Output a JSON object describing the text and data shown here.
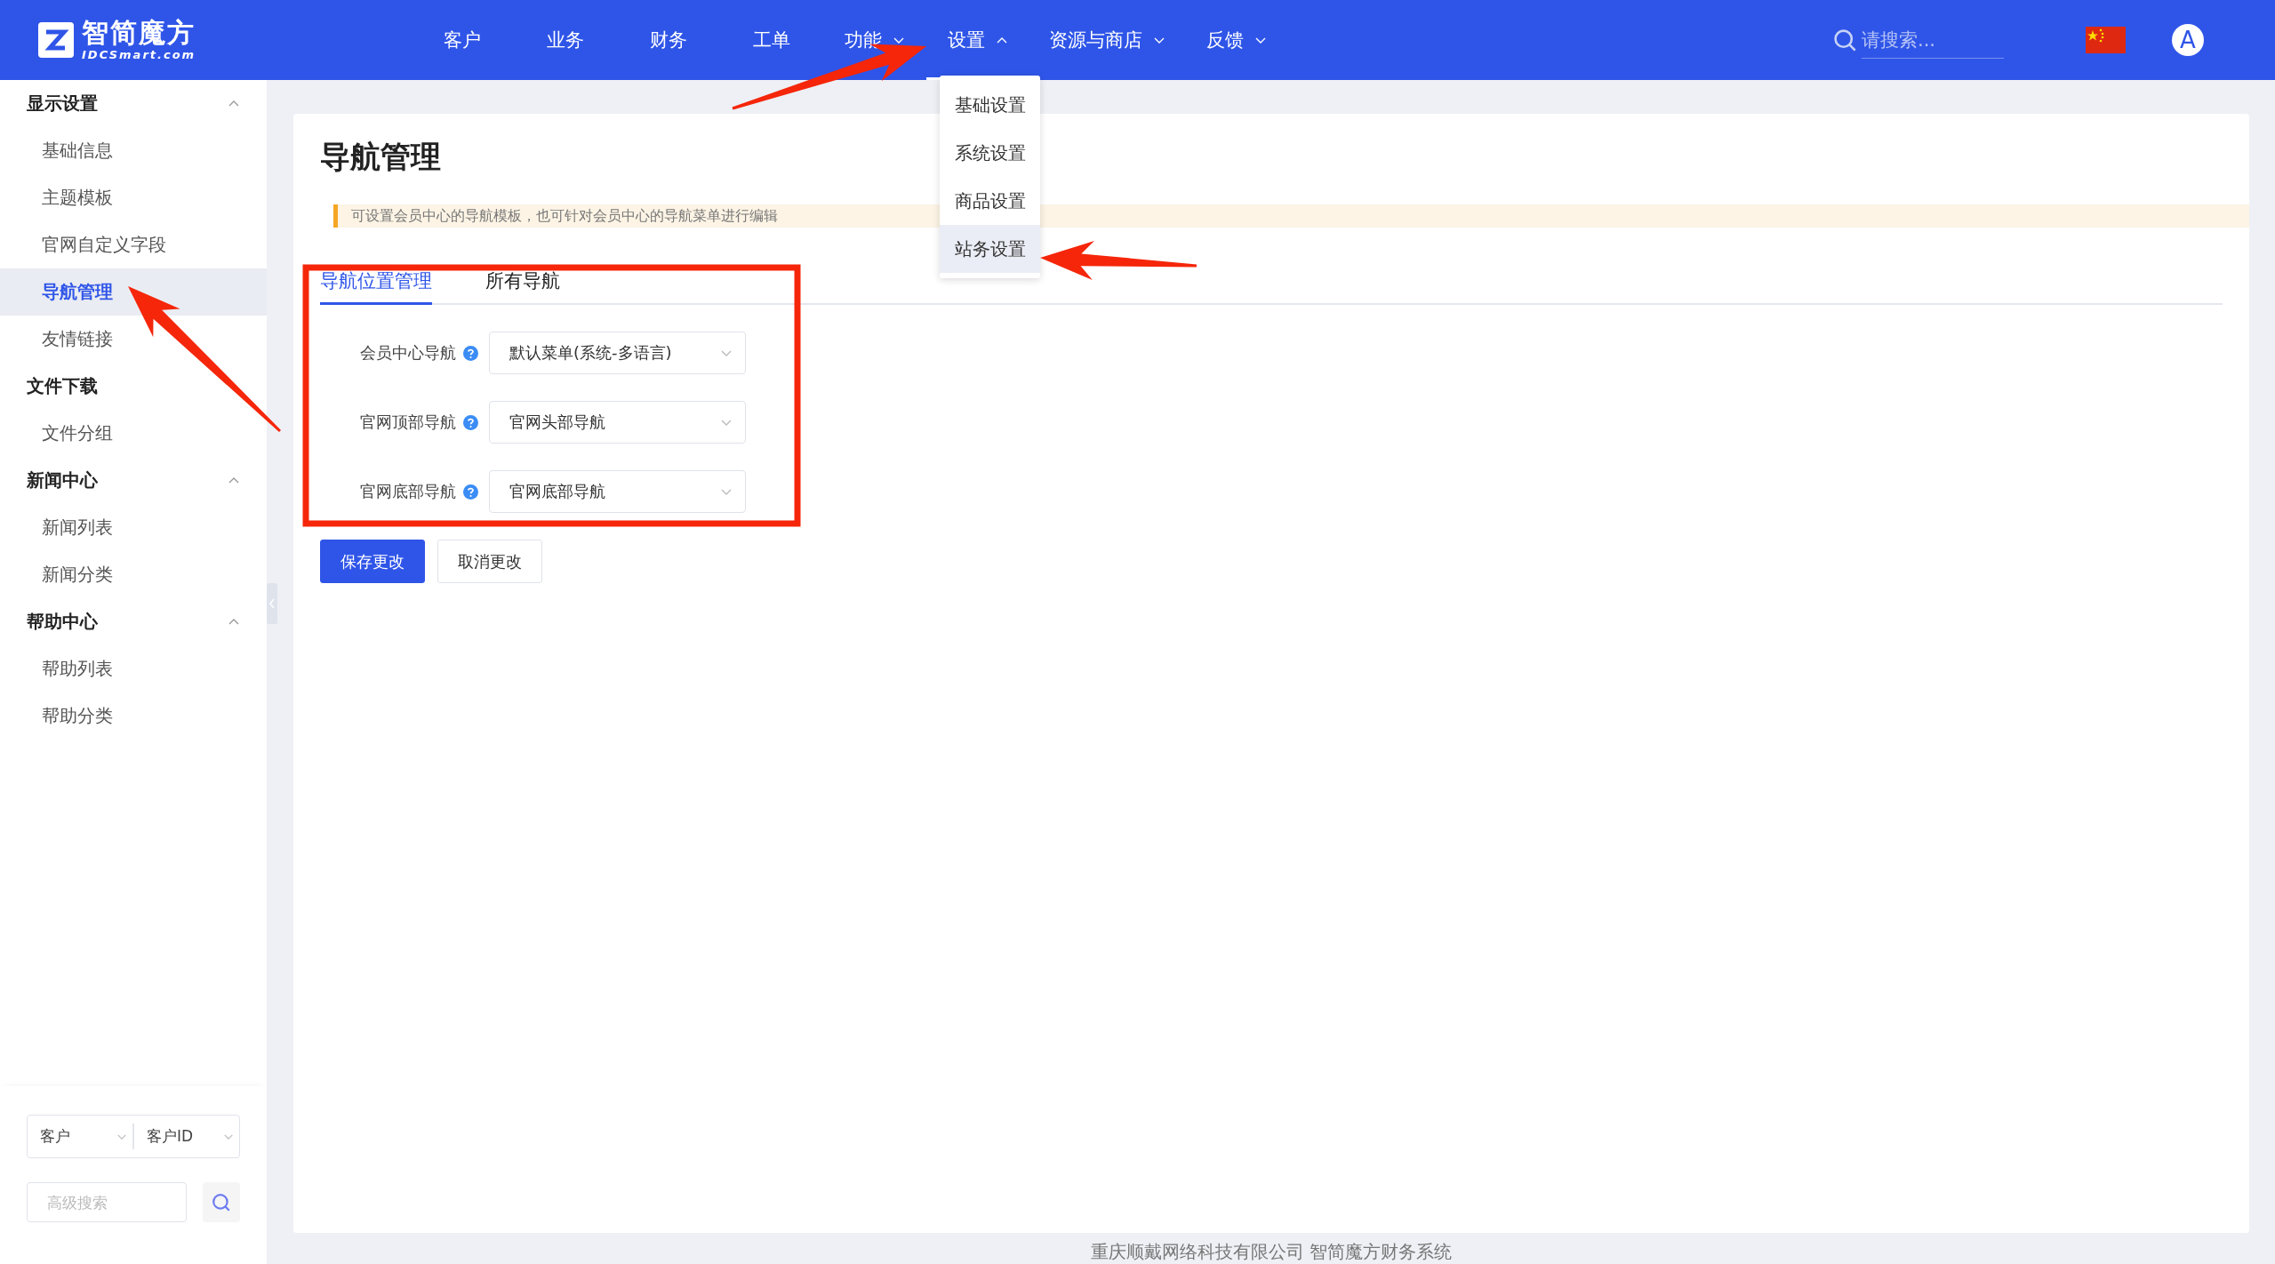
{
  "header": {
    "logo": {
      "name": "智简魔方",
      "domain": "IDCSmart.com"
    },
    "nav": [
      {
        "label": "客户",
        "kind": "link",
        "selected": false
      },
      {
        "label": "业务",
        "kind": "link",
        "selected": false
      },
      {
        "label": "财务",
        "kind": "link",
        "selected": false
      },
      {
        "label": "工单",
        "kind": "link",
        "selected": false
      },
      {
        "label": "功能",
        "kind": "menu",
        "expanded": false,
        "selected": false
      },
      {
        "label": "设置",
        "kind": "menu",
        "expanded": true,
        "selected": true
      },
      {
        "label": "资源与商店",
        "kind": "menu",
        "expanded": false,
        "selected": false
      },
      {
        "label": "反馈",
        "kind": "menu",
        "expanded": false,
        "selected": false
      }
    ],
    "search": {
      "placeholder": "请搜索..."
    },
    "avatar": "A"
  },
  "settings_menu": {
    "items": [
      {
        "label": "基础设置",
        "selected": false
      },
      {
        "label": "系统设置",
        "selected": false
      },
      {
        "label": "商品设置",
        "selected": false
      },
      {
        "label": "站务设置",
        "selected": true
      }
    ]
  },
  "sidebar": {
    "groups": [
      {
        "title": "显示设置",
        "kind": "collapsible",
        "expanded": true,
        "items": [
          {
            "label": "基础信息",
            "selected": false
          },
          {
            "label": "主题模板",
            "selected": false
          },
          {
            "label": "官网自定义字段",
            "selected": false
          },
          {
            "label": "导航管理",
            "selected": true
          },
          {
            "label": "友情链接",
            "selected": false
          }
        ]
      },
      {
        "title": "文件下载",
        "kind": "plain",
        "items": [
          {
            "label": "文件分组",
            "selected": false
          }
        ]
      },
      {
        "title": "新闻中心",
        "kind": "collapsible",
        "expanded": true,
        "items": [
          {
            "label": "新闻列表",
            "selected": false
          },
          {
            "label": "新闻分类",
            "selected": false
          }
        ]
      },
      {
        "title": "帮助中心",
        "kind": "collapsible",
        "expanded": true,
        "items": [
          {
            "label": "帮助列表",
            "selected": false
          },
          {
            "label": "帮助分类",
            "selected": false
          }
        ]
      }
    ],
    "search": {
      "scope": "客户",
      "field": "客户ID",
      "placeholder": "高级搜索"
    }
  },
  "page": {
    "title": "导航管理",
    "notice": "可设置会员中心的导航模板，也可针对会员中心的导航菜单进行编辑",
    "tabs": [
      {
        "label": "导航位置管理",
        "selected": true
      },
      {
        "label": "所有导航",
        "selected": false
      }
    ],
    "fields": [
      {
        "label": "会员中心导航",
        "value": "默认菜单(系统-多语言)"
      },
      {
        "label": "官网顶部导航",
        "value": "官网头部导航"
      },
      {
        "label": "官网底部导航",
        "value": "官网底部导航"
      }
    ],
    "buttons": [
      {
        "label": "保存更改",
        "kind": "primary"
      },
      {
        "label": "取消更改",
        "kind": "default"
      }
    ]
  },
  "footer": "重庆顺戴网络科技有限公司 智简魔方财务系统",
  "annotations": [
    {
      "kind": "box"
    },
    {
      "kind": "arrow"
    },
    {
      "kind": "arrow"
    },
    {
      "kind": "arrow"
    }
  ]
}
